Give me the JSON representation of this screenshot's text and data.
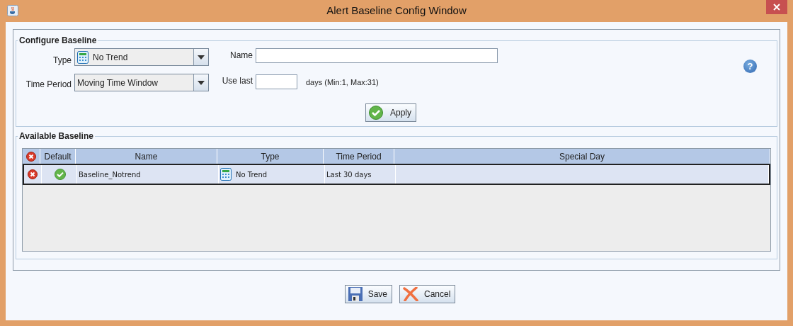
{
  "window": {
    "title": "Alert Baseline Config Window"
  },
  "configure": {
    "legend": "Configure Baseline",
    "type_label": "Type",
    "type_value": "No Trend",
    "period_label": "Time Period",
    "period_value": "Moving Time Window",
    "name_label": "Name",
    "use_last_label": "Use last",
    "days_hint": "days (Min:1, Max:31)",
    "help": "?",
    "apply": "Apply"
  },
  "available": {
    "legend": "Available Baseline",
    "table": {
      "columns": [
        "Default",
        "Name",
        "Type",
        "Time Period",
        "Special Day"
      ],
      "rows": [
        {
          "selected": true,
          "default": true,
          "name": "Baseline_Notrend",
          "type": "No Trend",
          "time_period": "Last 30 days"
        }
      ]
    }
  },
  "buttons": [
    {
      "kind": "save",
      "label": "Save"
    },
    {
      "kind": "cancel",
      "label": "Cancel"
    }
  ]
}
